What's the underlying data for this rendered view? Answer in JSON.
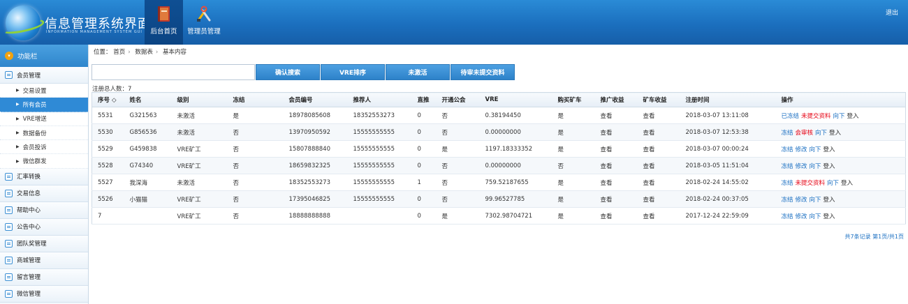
{
  "header": {
    "title": "信息管理系统界面",
    "subtitle": "INFORMATION MANAGEMENT SYSTEM GUI",
    "nav": [
      {
        "label": "后台首页",
        "icon": "book-icon"
      },
      {
        "label": "管理员管理",
        "icon": "tools-icon"
      }
    ],
    "logout": "退出"
  },
  "sidebar": {
    "title": "功能栏",
    "groups": [
      {
        "label": "会员管理",
        "items": [
          "交易设置",
          "所有会员",
          "VRE增送",
          "数据备份",
          "会员投诉",
          "微信群发"
        ]
      },
      {
        "label": "汇率转换"
      },
      {
        "label": "交易信息"
      },
      {
        "label": "帮助中心"
      },
      {
        "label": "公告中心"
      },
      {
        "label": "团队奖管理"
      },
      {
        "label": "商城管理"
      },
      {
        "label": "留言管理"
      },
      {
        "label": "微信管理"
      }
    ],
    "active_item": "所有会员"
  },
  "breadcrumb": {
    "label": "位置：",
    "items": [
      "首页",
      "数据表",
      "基本内容"
    ]
  },
  "toolbar": {
    "search_placeholder": "",
    "buttons": [
      "确认搜索",
      "VRE排序",
      "未激活",
      "待审未提交资料"
    ]
  },
  "summary": "注册总人数：7",
  "table": {
    "headers": [
      "序号 ◇",
      "姓名",
      "级别",
      "冻结",
      "会员编号",
      "推荐人",
      "直推",
      "开通公会",
      "VRE",
      "购买矿车",
      "推广收益",
      "矿车收益",
      "注册时间",
      "操作"
    ],
    "rows": [
      {
        "id": "5531",
        "name": "G321563",
        "level": "未激活",
        "frozen": "是",
        "member_no": "18978085608",
        "referrer": "18352553273",
        "direct": "0",
        "guild": "否",
        "vre": "0.38194450",
        "cart": "是",
        "promo": "查看",
        "mine": "查看",
        "time": "2018-03-07 13:11:08",
        "actions": [
          {
            "t": "已冻结",
            "c": "blue"
          },
          {
            "t": "未提交资料",
            "c": "red"
          },
          {
            "t": "向下",
            "c": "blue"
          },
          {
            "t": "登入",
            "c": "dark"
          }
        ]
      },
      {
        "id": "5530",
        "name": "G856536",
        "level": "未激活",
        "frozen": "否",
        "member_no": "13970950592",
        "referrer": "15555555555",
        "direct": "0",
        "guild": "否",
        "vre": "0.00000000",
        "cart": "是",
        "promo": "查看",
        "mine": "查看",
        "time": "2018-03-07 12:53:38",
        "actions": [
          {
            "t": "冻结",
            "c": "blue"
          },
          {
            "t": "会审核",
            "c": "red"
          },
          {
            "t": "向下",
            "c": "blue"
          },
          {
            "t": "登入",
            "c": "dark"
          }
        ]
      },
      {
        "id": "5529",
        "name": "G459838",
        "level": "VRE矿工",
        "frozen": "否",
        "member_no": "15807888840",
        "referrer": "15555555555",
        "direct": "0",
        "guild": "是",
        "vre": "1197.18333352",
        "cart": "是",
        "promo": "查看",
        "mine": "查看",
        "time": "2018-03-07 00:00:24",
        "actions": [
          {
            "t": "冻结",
            "c": "blue"
          },
          {
            "t": "修改",
            "c": "blue"
          },
          {
            "t": "向下",
            "c": "blue"
          },
          {
            "t": "登入",
            "c": "dark"
          }
        ]
      },
      {
        "id": "5528",
        "name": "G74340",
        "level": "VRE矿工",
        "frozen": "否",
        "member_no": "18659832325",
        "referrer": "15555555555",
        "direct": "0",
        "guild": "否",
        "vre": "0.00000000",
        "cart": "否",
        "promo": "查看",
        "mine": "查看",
        "time": "2018-03-05 11:51:04",
        "actions": [
          {
            "t": "冻结",
            "c": "blue"
          },
          {
            "t": "修改",
            "c": "blue"
          },
          {
            "t": "向下",
            "c": "blue"
          },
          {
            "t": "登入",
            "c": "dark"
          }
        ]
      },
      {
        "id": "5527",
        "name": "我深海",
        "level": "未激活",
        "frozen": "否",
        "member_no": "18352553273",
        "referrer": "15555555555",
        "direct": "1",
        "guild": "否",
        "vre": "759.52187655",
        "cart": "是",
        "promo": "查看",
        "mine": "查看",
        "time": "2018-02-24 14:55:02",
        "actions": [
          {
            "t": "冻结",
            "c": "blue"
          },
          {
            "t": "未提交资料",
            "c": "red"
          },
          {
            "t": "向下",
            "c": "blue"
          },
          {
            "t": "登入",
            "c": "dark"
          }
        ]
      },
      {
        "id": "5526",
        "name": "小猫猫",
        "level": "VRE矿工",
        "frozen": "否",
        "member_no": "17395046825",
        "referrer": "15555555555",
        "direct": "0",
        "guild": "否",
        "vre": "99.96527785",
        "cart": "是",
        "promo": "查看",
        "mine": "查看",
        "time": "2018-02-24 00:37:05",
        "actions": [
          {
            "t": "冻结",
            "c": "blue"
          },
          {
            "t": "修改",
            "c": "blue"
          },
          {
            "t": "向下",
            "c": "blue"
          },
          {
            "t": "登入",
            "c": "dark"
          }
        ]
      },
      {
        "id": "7",
        "name": "",
        "level": "VRE矿工",
        "frozen": "否",
        "member_no": "18888888888",
        "referrer": "",
        "direct": "0",
        "guild": "是",
        "vre": "7302.98704721",
        "cart": "是",
        "promo": "查看",
        "mine": "查看",
        "time": "2017-12-24 22:59:09",
        "actions": [
          {
            "t": "冻结",
            "c": "blue"
          },
          {
            "t": "修改",
            "c": "blue"
          },
          {
            "t": "向下",
            "c": "blue"
          },
          {
            "t": "登入",
            "c": "dark"
          }
        ]
      }
    ]
  },
  "pager": "共7条记录 第1页/共1页",
  "colors": {
    "header": "#1b6fbe",
    "accent": "#2f8ad6",
    "danger": "#e60012",
    "link": "#1a6fc2"
  }
}
